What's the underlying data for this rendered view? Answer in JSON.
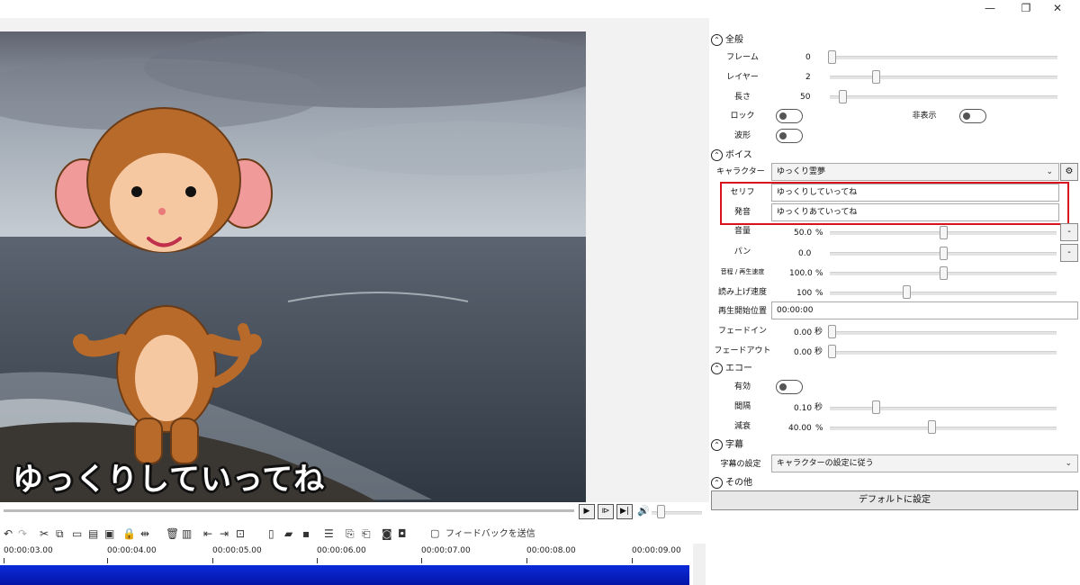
{
  "window": {
    "minimize": "—",
    "restore": "❐",
    "close": "✕"
  },
  "preview": {
    "caption": "ゆっくりしていってね"
  },
  "playback": {
    "play": "▶",
    "step": "⧐",
    "next": "▶|",
    "volume_icon": "🔊"
  },
  "toolbar": {
    "feedback_label": "フィードバックを送信"
  },
  "timeline": {
    "ticks": [
      "00:00:03.00",
      "00:00:04.00",
      "00:00:05.00",
      "00:00:06.00",
      "00:00:07.00",
      "00:00:08.00",
      "00:00:09.00"
    ],
    "track_color": "#0b2bd8"
  },
  "panel": {
    "general": {
      "header": "全般",
      "frame_label": "フレーム",
      "frame_value": "0",
      "layer_label": "レイヤー",
      "layer_value": "2",
      "length_label": "長さ",
      "length_value": "50",
      "lock_label": "ロック",
      "hidden_label": "非表示",
      "waveform_label": "波形"
    },
    "voice": {
      "header": "ボイス",
      "character_label": "キャラクター",
      "character_value": "ゆっくり霊夢",
      "line_label": "セリフ",
      "line_value": "ゆっくりしていってね",
      "pronunciation_label": "発音",
      "pronunciation_value": "ゆっくりあていってね",
      "volume_label": "音量",
      "volume_value": "50.0",
      "pan_label": "パン",
      "pan_value": "0.0",
      "pitch_label": "音程 / 再生速度",
      "pitch_value": "100.0",
      "read_speed_label": "読み上げ速度",
      "read_speed_value": "100",
      "start_label": "再生開始位置",
      "start_value": "00:00:00",
      "fadein_label": "フェードイン",
      "fadein_value": "0.00",
      "fadeout_label": "フェードアウト",
      "fadeout_value": "0.00",
      "percent_unit": "%",
      "sec_unit": "秒",
      "side_minus": "-",
      "side_plus": "+"
    },
    "echo": {
      "header": "エコー",
      "enabled_label": "有効",
      "interval_label": "間隔",
      "interval_value": "0.10",
      "decay_label": "減衰",
      "decay_value": "40.00",
      "sec_unit": "秒",
      "percent_unit": "%"
    },
    "subtitle": {
      "header": "字幕",
      "setting_label": "字幕の設定",
      "setting_value": "キャラクターの設定に従う"
    },
    "other": {
      "header": "その他",
      "default_button": "デフォルトに設定"
    },
    "accent_color": "#d7141c"
  }
}
